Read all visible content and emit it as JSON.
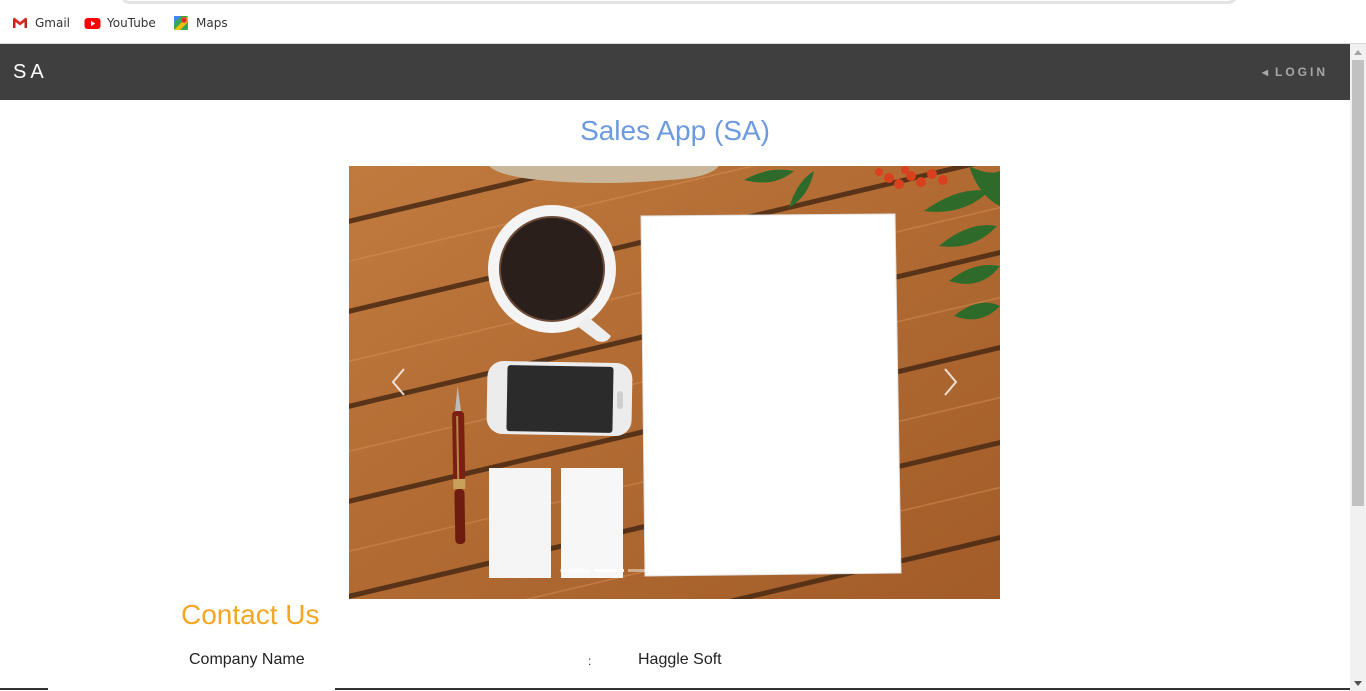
{
  "bookmarks": [
    {
      "label": "Gmail",
      "icon": "gmail-icon"
    },
    {
      "label": "YouTube",
      "icon": "youtube-icon"
    },
    {
      "label": "Maps",
      "icon": "maps-icon"
    }
  ],
  "navbar": {
    "brand": "SA",
    "login_label": "LOGIN",
    "login_icon": "caret-left-icon",
    "background": "#3f3f40"
  },
  "main": {
    "title": "Sales App (SA)",
    "title_color": "#6c9ae0"
  },
  "carousel": {
    "image_description_icon": "desk-flatlay-image",
    "prev_icon": "chevron-left-icon",
    "next_icon": "chevron-right-icon",
    "slide_count": 3,
    "active_slide": 2
  },
  "contact": {
    "heading": "Contact Us",
    "heading_color": "#f5a623",
    "rows": [
      {
        "label": "Company Name",
        "separator": ":",
        "value": "Haggle Soft"
      }
    ]
  }
}
